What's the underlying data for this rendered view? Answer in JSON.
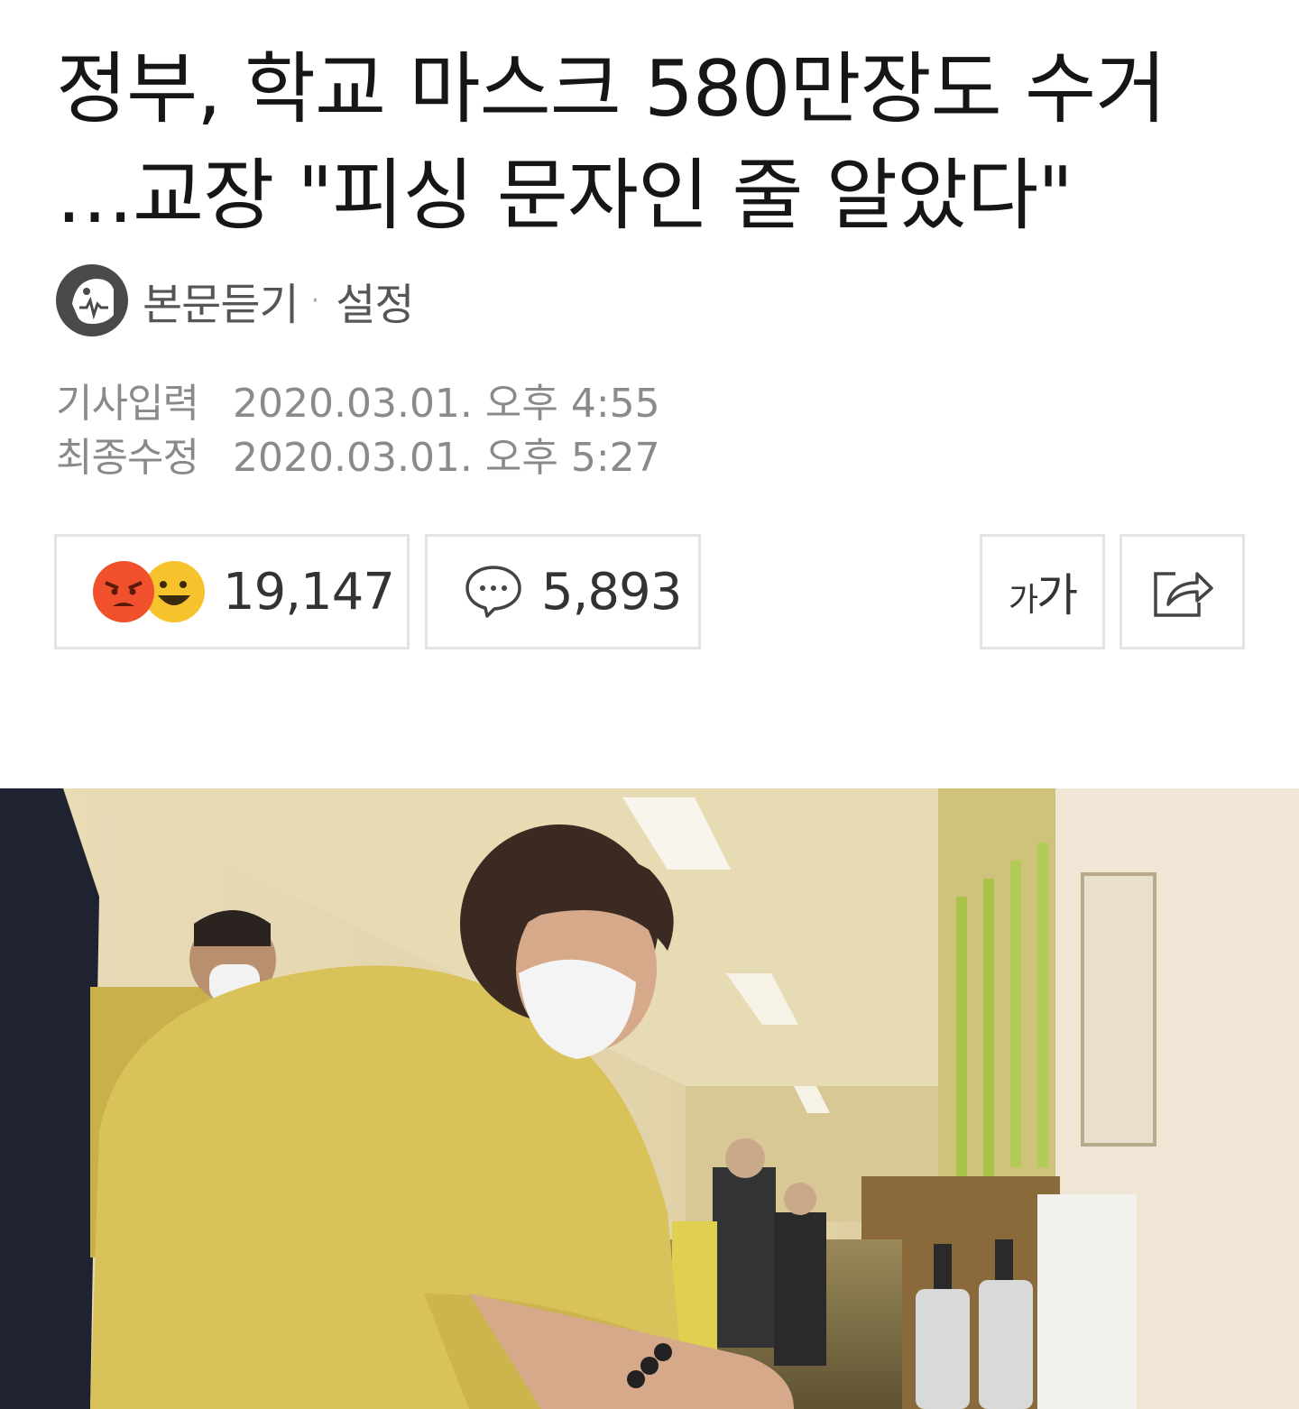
{
  "article": {
    "headline_line1": "정부, 학교 마스크 580만장도 수거",
    "headline_line2": "…교장 \"피싱 문자인 줄 알았다\"",
    "tts": {
      "listen_label": "본문듣기",
      "separator": "·",
      "settings_label": "설정"
    },
    "meta": {
      "input_label": "기사입력",
      "input_value": "2020.03.01. 오후 4:55",
      "modified_label": "최종수정",
      "modified_value": "2020.03.01. 오후 5:27"
    }
  },
  "actions": {
    "reactions": {
      "count": "19,147",
      "icons": [
        "angry-face-icon",
        "happy-face-icon"
      ],
      "colors": {
        "angry": "#f0502c",
        "happy": "#f7c32c"
      }
    },
    "comments": {
      "count": "5,893",
      "icon": "speech-bubble-icon"
    },
    "font_size": {
      "label_small": "가",
      "label_large": "가"
    },
    "share": {
      "icon": "share-icon"
    }
  },
  "photo": {
    "icon": "news-photo",
    "colors": {
      "jacket": "#d8c25a",
      "wall": "#efe3c2",
      "ceiling": "#e8dcb6"
    }
  }
}
